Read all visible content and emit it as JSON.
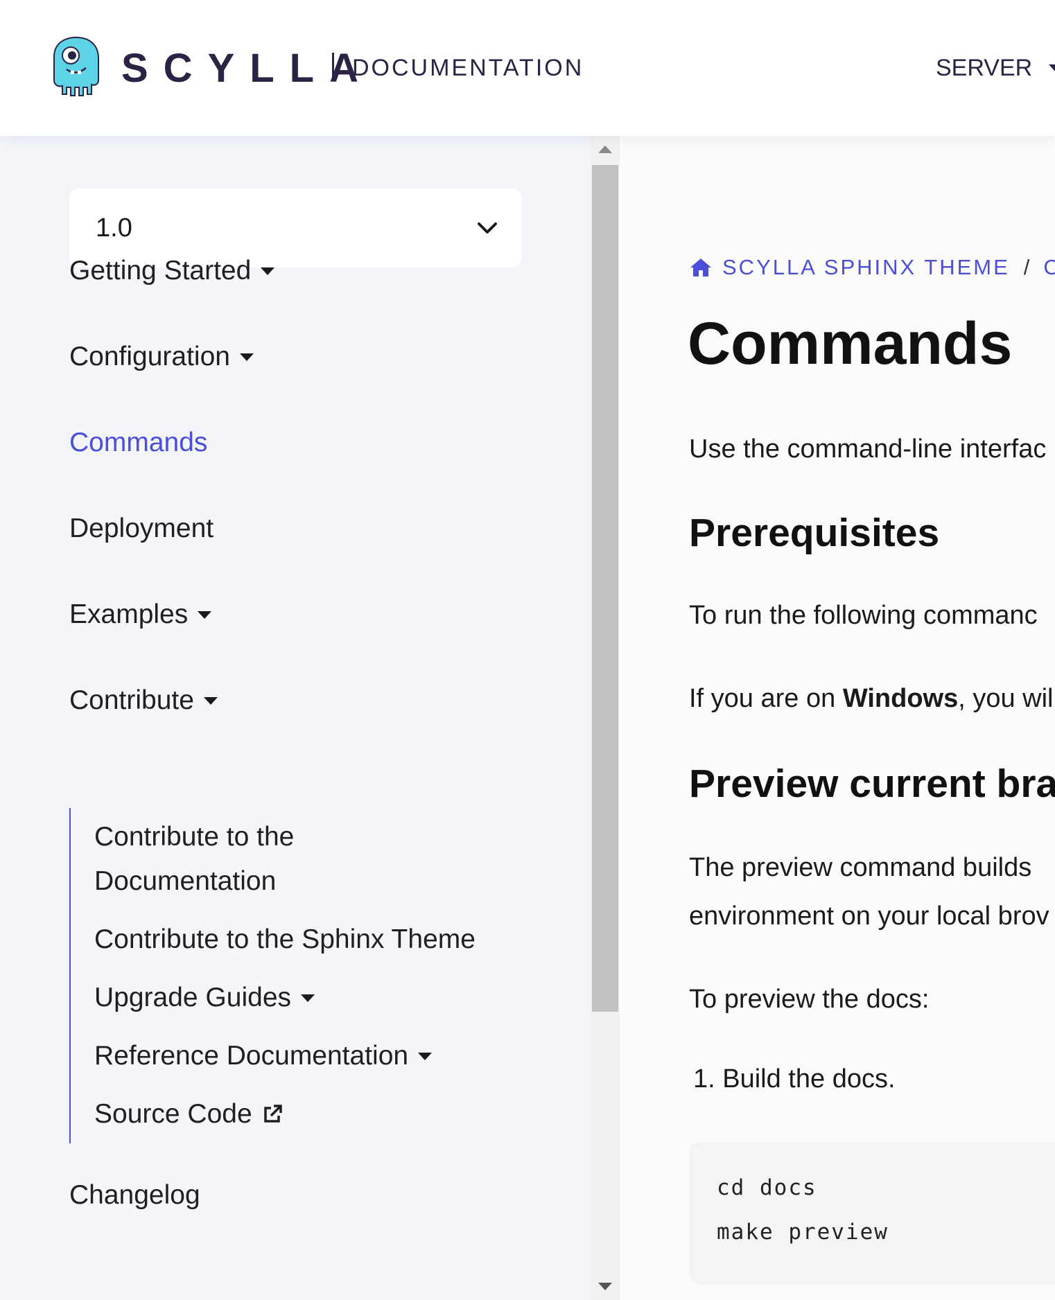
{
  "header": {
    "logo_alt": "Scylla mascot logo",
    "brand": "SCYLLA",
    "section_label": "DOCUMENTATION",
    "product_menu_label": "SERVER"
  },
  "sidebar": {
    "version_select_value": "1.0",
    "nav_items": [
      {
        "label": "Getting Started",
        "has_caret": true
      },
      {
        "label": "Configuration",
        "has_caret": true
      },
      {
        "label": "Commands",
        "active": true
      },
      {
        "label": "Deployment"
      },
      {
        "label": "Examples",
        "has_caret": true
      },
      {
        "label": "Contribute",
        "has_caret": true,
        "expanded": true
      }
    ],
    "contribute_children": [
      {
        "label_line1": "Contribute to the",
        "label_line2": "Documentation"
      },
      {
        "label": "Contribute to the Sphinx Theme"
      },
      {
        "label": "Upgrade Guides",
        "has_caret": true
      },
      {
        "label": "Reference Documentation",
        "has_caret": true
      },
      {
        "label": "Source Code",
        "icon": "external-link-icon"
      }
    ],
    "changelog_label": "Changelog"
  },
  "content": {
    "breadcrumb": {
      "home_icon": "home-icon",
      "root": "SCYLLA SPHINX THEME",
      "separator": "/",
      "current": "CC"
    },
    "title": "Commands",
    "intro": "Use the command-line interfac",
    "prereq_heading": "Prerequisites",
    "prereq_text": "To run the following commanc",
    "windows_prefix": "If you are on ",
    "windows_bold": "Windows",
    "windows_suffix": ", you wil",
    "preview_heading": "Preview current bra",
    "preview_text_line1": "The preview command builds",
    "preview_text_line2": "environment on your local brov",
    "preview_lead": "To preview the docs:",
    "steps": [
      "1. Build the docs."
    ],
    "code_lines": [
      "cd docs",
      "make preview"
    ]
  },
  "colors": {
    "accent": "#4a4fd6",
    "brand_dark": "#2b2244",
    "mascot": "#5dd3e8",
    "sidebar_bg": "#f3f5fb"
  }
}
